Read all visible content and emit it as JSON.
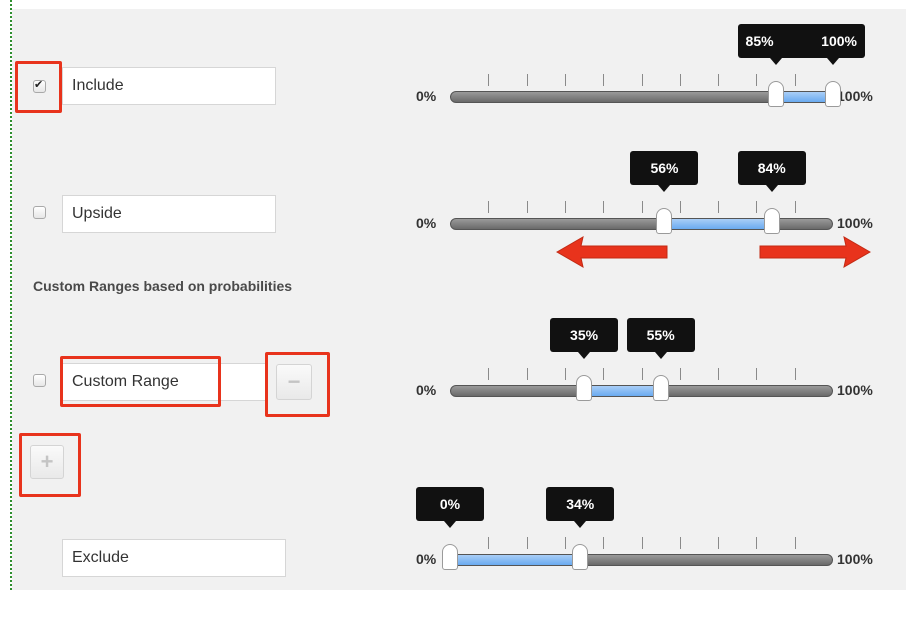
{
  "section_heading": "Custom Ranges based on probabilities",
  "rows": [
    {
      "name": "Include",
      "checked": true,
      "min_label": "0%",
      "max_label": "100%",
      "lower": 85,
      "upper": 100,
      "lower_text": "85%",
      "upper_text": "100%"
    },
    {
      "name": "Upside",
      "checked": false,
      "min_label": "0%",
      "max_label": "100%",
      "lower": 56,
      "upper": 84,
      "lower_text": "56%",
      "upper_text": "84%"
    },
    {
      "name": "Custom Range",
      "checked": false,
      "min_label": "0%",
      "max_label": "100%",
      "lower": 35,
      "upper": 55,
      "lower_text": "35%",
      "upper_text": "55%"
    },
    {
      "name": "Exclude",
      "checked": false,
      "min_label": "0%",
      "max_label": "100%",
      "lower": 0,
      "upper": 34,
      "lower_text": "0%",
      "upper_text": "34%"
    }
  ],
  "buttons": {
    "remove_icon": "minus-icon",
    "add_icon": "plus-icon"
  },
  "colors": {
    "highlight": "#e8331c",
    "range_fill": "#6aaaf0",
    "arrow": "#e8331c"
  }
}
